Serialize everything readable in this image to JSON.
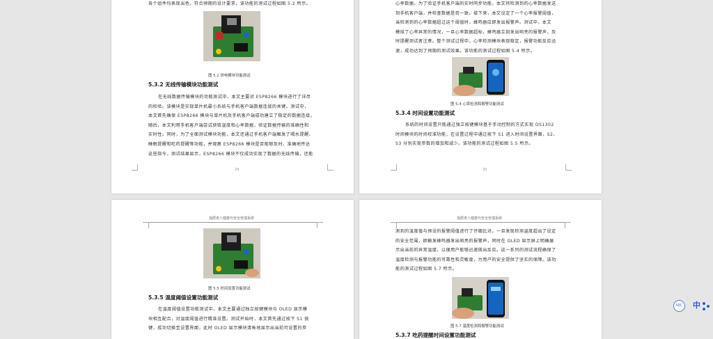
{
  "page1": {
    "top_text": "各个组件均表现出色，符合预期的设计要求，该功能的测试过程如图 5.2 所示。",
    "figure_caption": "图 5.2 供电模块功能测试",
    "section_heading": "5.3.2 无线传输模块功能测试",
    "paragraph_lines": [
      "在无线数据传输模块的功能测试中，本文主要对 ESP8266 模块进行了详尽",
      "的检验。该模块是实现单片机最小系统与手机客户端数据连接的关键。测试中，",
      "本文首先确保 ESP8266 模块与单片机及手机客户端成功建立了稳定的数据连接。",
      "随后，本文利用手机客户端尝试获取温度和心率数据，验证数据传输的准确性和",
      "实时性。同时，为了全面测试模块功能，本文还通过手机客户端触发了喝水提醒、",
      "睡眠提醒和吃药提醒等功能，并观察 ESP8266 模块是否能够及时、准确地传达",
      "这些指令。测试结果显示，ESP8266 模块不仅成功实现了数据的无线传输，还能"
    ],
    "page_number": "29"
  },
  "page2": {
    "paragraph_lines": [
      "心率数据。为了验证手机客户端的实时同步功能，本文将检测到的心率数据发送",
      "到手机客户端，并检查数据是否一致。接下来，本文设定了一个心率报警阈值，",
      "当检测到的心率数据超过这个阈值时，蜂鸣器应即发出报警声。测试中，本文",
      "模拟了心率异常的情况，一旦心率数据超标，蜂鸣器立刻发出响亮的报警声，及",
      "时提醒测试者注意。整个测试过程中，心率检测模块表现稳定，报警功能反应迅",
      "速，成功达到了预期的测试效果。该功能的测试过程如图 5.4 所示。"
    ],
    "figure_caption": "图 5.4 心率检测和报警功能测试",
    "section_heading": "5.3.4 时间设置功能测试",
    "paragraph2_lines": [
      "系统的时间设置只能通过独立按键模块基于手动控制的方式实现 DS1302",
      "时间模块的时间校准功能，在设置过程中通过按下 S1 进入时间设置界面，S2、",
      "S3 分别实现参数的增加和减少。该功能的测试过程如图 5.5 所示。"
    ],
    "page_number": "30"
  },
  "page3": {
    "running_header": "独居老人健康与安全管理系统",
    "figure_caption": "图 5.5 时间设置功能测试",
    "section_heading": "5.3.5 温度阈值设置功能测试",
    "paragraph_lines": [
      "在温度阈值设置功能测试中，本文主要通过独立按键模块与 OLED 显示模",
      "块相互配合，对温度阈值进行精准设置。测试开始时，本文首先通过按下 S1 按",
      "键，成功切换至设置界面，此时 OLED 显示模块清晰地显示出当前可设置的参"
    ]
  },
  "page4": {
    "running_header": "独居老人健康与安全管理系统",
    "paragraph_lines": [
      "测到的温度值与预设的报警阈值进行了仔细比对。一旦发现检测温度超出了设定",
      "的安全范围，即触发蜂鸣器发出响亮的报警声，同时在 OLED 显示屏上明确展",
      "示出当前的异常温度，以便用户能够迅速做出反应。这一系列的测试流程确保了",
      "温度检测与报警功能的可靠性和灵敏度，为用户的安全提供了坚实的保障。该功",
      "能的测试过程如图 5.7 所示。"
    ],
    "figure_caption": "图 5.7 温度检测和报警功能测试",
    "section_heading": "5.3.7 吃药提醒时间设置功能测试"
  },
  "widgets": {
    "translate_label": "ABC",
    "lang_label": "中",
    "dots_icon": "dots-icon"
  },
  "colors": {
    "board_green": "#2e7d32",
    "phone_blue": "#1565c0",
    "accent": "#2a5bd7"
  }
}
